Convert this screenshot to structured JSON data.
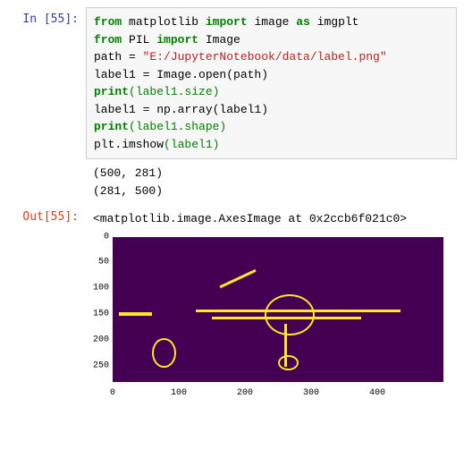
{
  "input": {
    "prompt": "In [55]:",
    "code": {
      "l1_from": "from",
      "l1_mod": " matplotlib ",
      "l1_import": "import",
      "l1_rest": " image ",
      "l1_as": "as",
      "l1_alias": " imgplt",
      "l2_from": "from",
      "l2_mod": " PIL ",
      "l2_import": "import",
      "l2_rest": " Image",
      "l3_a": "path = ",
      "l3_str": "\"E:/JupyterNotebook/data/label.png\"",
      "l4": "label1 = Image.open(path)",
      "l5_a": "print",
      "l5_b": "(label1.size)",
      "l6": "label1 = np.array(label1)",
      "l7_a": "print",
      "l7_b": "(label1.shape)",
      "l8_a": "plt.imshow",
      "l8_b": "(label1)"
    }
  },
  "stdout": "(500, 281)\n(281, 500)",
  "output": {
    "prompt": "Out[55]:",
    "text": "<matplotlib.image.AxesImage at 0x2ccb6f021c0>"
  },
  "chart_data": {
    "type": "heatmap",
    "xlabel": "",
    "ylabel": "",
    "xlim": [
      0,
      499
    ],
    "ylim": [
      280,
      0
    ],
    "xticks": [
      0,
      100,
      200,
      300,
      400
    ],
    "yticks": [
      0,
      50,
      100,
      150,
      200,
      250
    ],
    "description": "Binary label mask on purple background, yellow outline of an airplane shape plus small detached blobs on the left"
  }
}
